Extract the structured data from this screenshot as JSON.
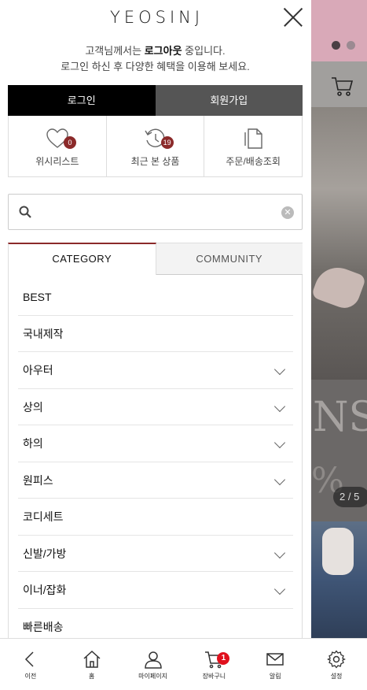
{
  "header": {
    "logo_text": "YEOSINJ"
  },
  "greeting": {
    "line1_prefix": "고객님께서는 ",
    "line1_bold": "로그아웃",
    "line1_suffix": " 중입니다.",
    "line2": "로그인 하신 후 다양한 혜택을 이용해 보세요."
  },
  "auth": {
    "login_label": "로그인",
    "join_label": "회원가입"
  },
  "quick_links": [
    {
      "label": "위시리스트",
      "icon": "heart-icon",
      "badge": "0"
    },
    {
      "label": "최근 본 상품",
      "icon": "history-icon",
      "badge": "19"
    },
    {
      "label": "주문/배송조회",
      "icon": "document-icon"
    }
  ],
  "search": {
    "value": "",
    "placeholder": ""
  },
  "tabs": [
    {
      "label": "CATEGORY",
      "active": true
    },
    {
      "label": "COMMUNITY",
      "active": false
    }
  ],
  "categories": [
    {
      "label": "BEST",
      "expandable": false
    },
    {
      "label": "국내제작",
      "expandable": false
    },
    {
      "label": "아우터",
      "expandable": true
    },
    {
      "label": "상의",
      "expandable": true
    },
    {
      "label": "하의",
      "expandable": true
    },
    {
      "label": "원피스",
      "expandable": true
    },
    {
      "label": "코디세트",
      "expandable": false
    },
    {
      "label": "신발/가방",
      "expandable": true
    },
    {
      "label": "이너/잡화",
      "expandable": true
    },
    {
      "label": "빠른배송",
      "expandable": false
    }
  ],
  "background_page": {
    "slider_counter": "2 / 5"
  },
  "bottom_nav": [
    {
      "label": "이전",
      "icon": "back-arrow-icon"
    },
    {
      "label": "홈",
      "icon": "home-icon"
    },
    {
      "label": "마이페이지",
      "icon": "user-icon"
    },
    {
      "label": "장바구니",
      "icon": "cart-icon",
      "badge": "1"
    },
    {
      "label": "알림",
      "icon": "mail-icon"
    },
    {
      "label": "설정",
      "icon": "gear-icon"
    }
  ],
  "colors": {
    "accent": "#8b2a2a",
    "login_bg": "#000000",
    "join_bg": "#555555",
    "cart_badge": "#e0101d"
  }
}
